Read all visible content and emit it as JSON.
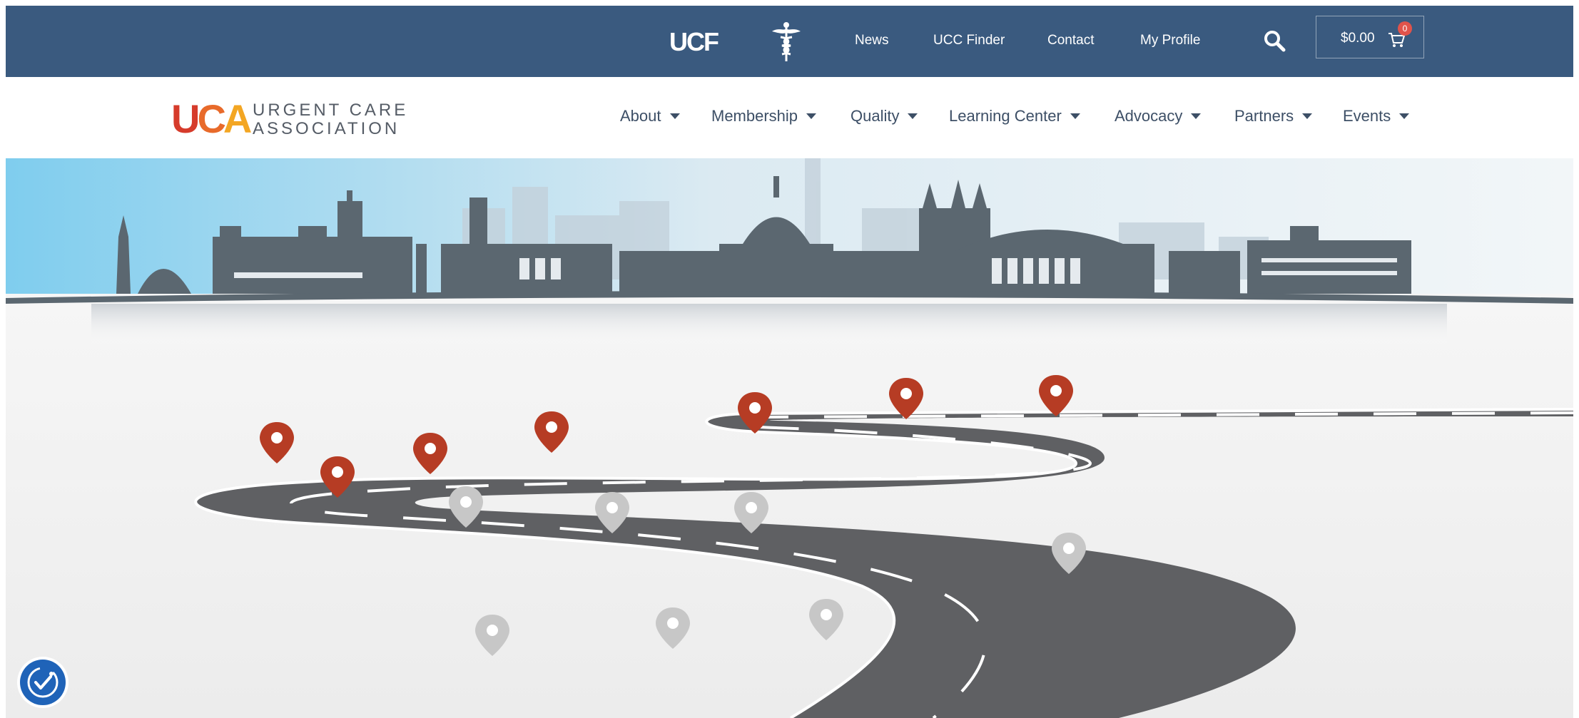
{
  "topbar": {
    "ucf_logo": "UCF",
    "links": [
      "News",
      "UCC Finder",
      "Contact",
      "My Profile"
    ],
    "cart_amount": "$0.00",
    "cart_count": "0",
    "colors": {
      "background": "#3a5a7f",
      "badge": "#e1534b"
    }
  },
  "header": {
    "logo_mark": {
      "u": "U",
      "c": "C",
      "a": "A"
    },
    "logo_line1": "URGENT CARE",
    "logo_line2": "ASSOCIATION",
    "nav": [
      "About",
      "Membership",
      "Quality",
      "Learning Center",
      "Advocacy",
      "Partners",
      "Events"
    ]
  },
  "hero": {
    "active_pin_color": "#b63c24",
    "inactive_pin_color": "#c7c7c7",
    "road_color": "#5f6063"
  }
}
